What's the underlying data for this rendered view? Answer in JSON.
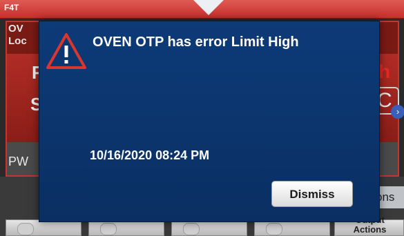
{
  "header": {
    "app_label": "F4T"
  },
  "background_screen": {
    "profile_line1": "OV",
    "profile_line2": "Loc",
    "row1_left": "F",
    "row1_right": "h",
    "row2_left": "S",
    "row2_right": "C",
    "footer_left": "PW",
    "actions_partial": "ons"
  },
  "bottom_bar": {
    "output_actions_line1": "Output",
    "output_actions_line2": "Actions"
  },
  "alert": {
    "title": "OVEN OTP has error Limit High",
    "timestamp": "10/16/2020 08:24 PM",
    "dismiss_label": "Dismiss",
    "icon": "warning-triangle-icon"
  },
  "colors": {
    "header_red": "#c6302c",
    "modal_blue": "#0d3b78",
    "warning_red": "#d9362e"
  }
}
